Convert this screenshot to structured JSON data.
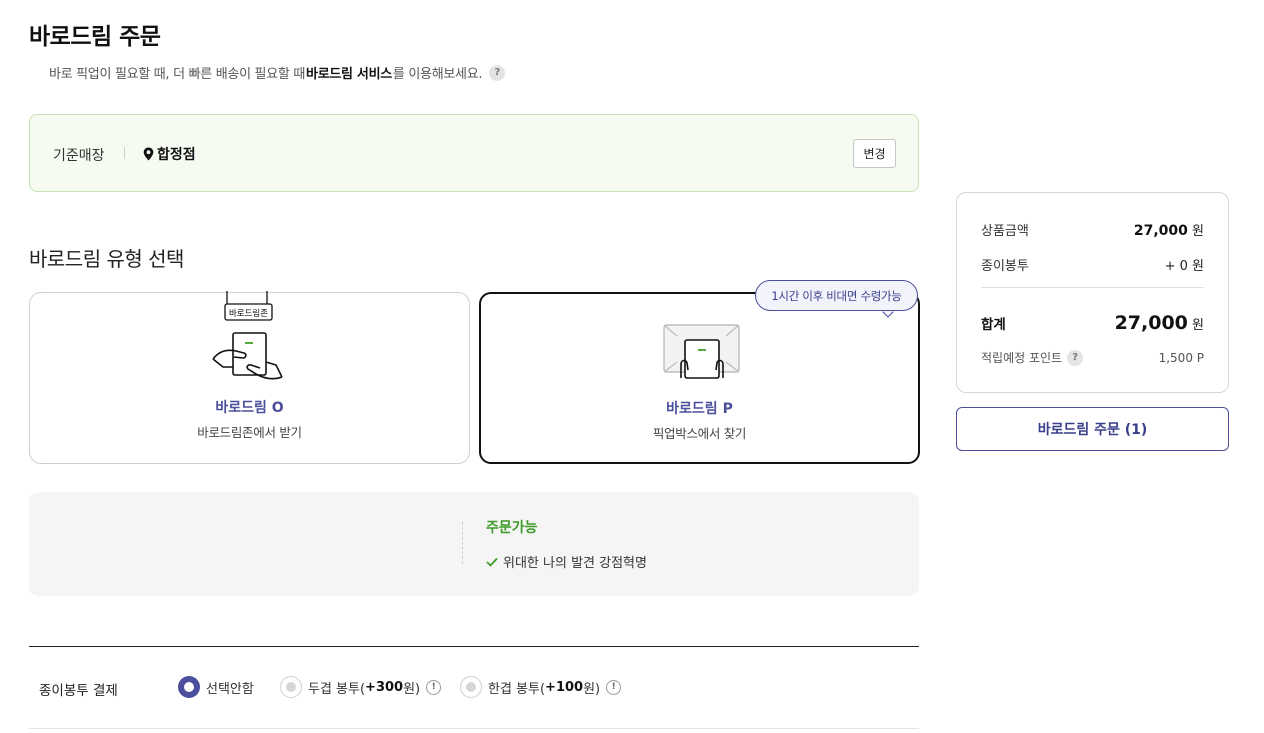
{
  "header": {
    "title": "바로드림 주문",
    "subtitle_pre": "바로 픽업이 필요할 때, 더 빠른 배송이 필요할 때 ",
    "subtitle_bold": "바로드림 서비스",
    "subtitle_post": "를 이용해보세요.",
    "help_symbol": "?"
  },
  "store": {
    "label": "기준매장",
    "name": "합정점",
    "change_label": "변경"
  },
  "type_section": {
    "title": "바로드림 유형 선택",
    "options": [
      {
        "title": "바로드림 O",
        "desc": "바로드림존에서 받기",
        "badge": "바로드림존",
        "selected": false
      },
      {
        "title": "바로드림 P",
        "desc": "픽업박스에서 찾기",
        "selected": true
      }
    ],
    "tooltip": "1시간 이후 비대면 수령가능"
  },
  "availability": {
    "status": "주문가능",
    "items": [
      "위대한 나의 발견 강점혁명"
    ]
  },
  "paper_bag": {
    "label": "종이봉투 결제",
    "options": [
      {
        "label": "선택안함",
        "selected": true
      },
      {
        "label_pre": "두겹 봉투(",
        "label_bold": "+300",
        "label_post": "원)",
        "selected": false
      },
      {
        "label_pre": "한겹 봉투(",
        "label_bold": "+100",
        "label_post": "원)",
        "selected": false
      }
    ],
    "warn_symbol": "!"
  },
  "summary": {
    "product_label": "상품금액",
    "product_amount": "27,000",
    "bag_label": "종이봉투",
    "bag_amount": "+ 0",
    "total_label": "합계",
    "total_amount": "27,000",
    "currency": "원",
    "points_label": "적립예정 포인트",
    "points_value": "1,500 P"
  },
  "order_button": "바로드림 주문 (1)",
  "colors": {
    "accent": "#4b4f9c",
    "success": "#3d9b27",
    "store_bg": "#f6fbf2"
  }
}
